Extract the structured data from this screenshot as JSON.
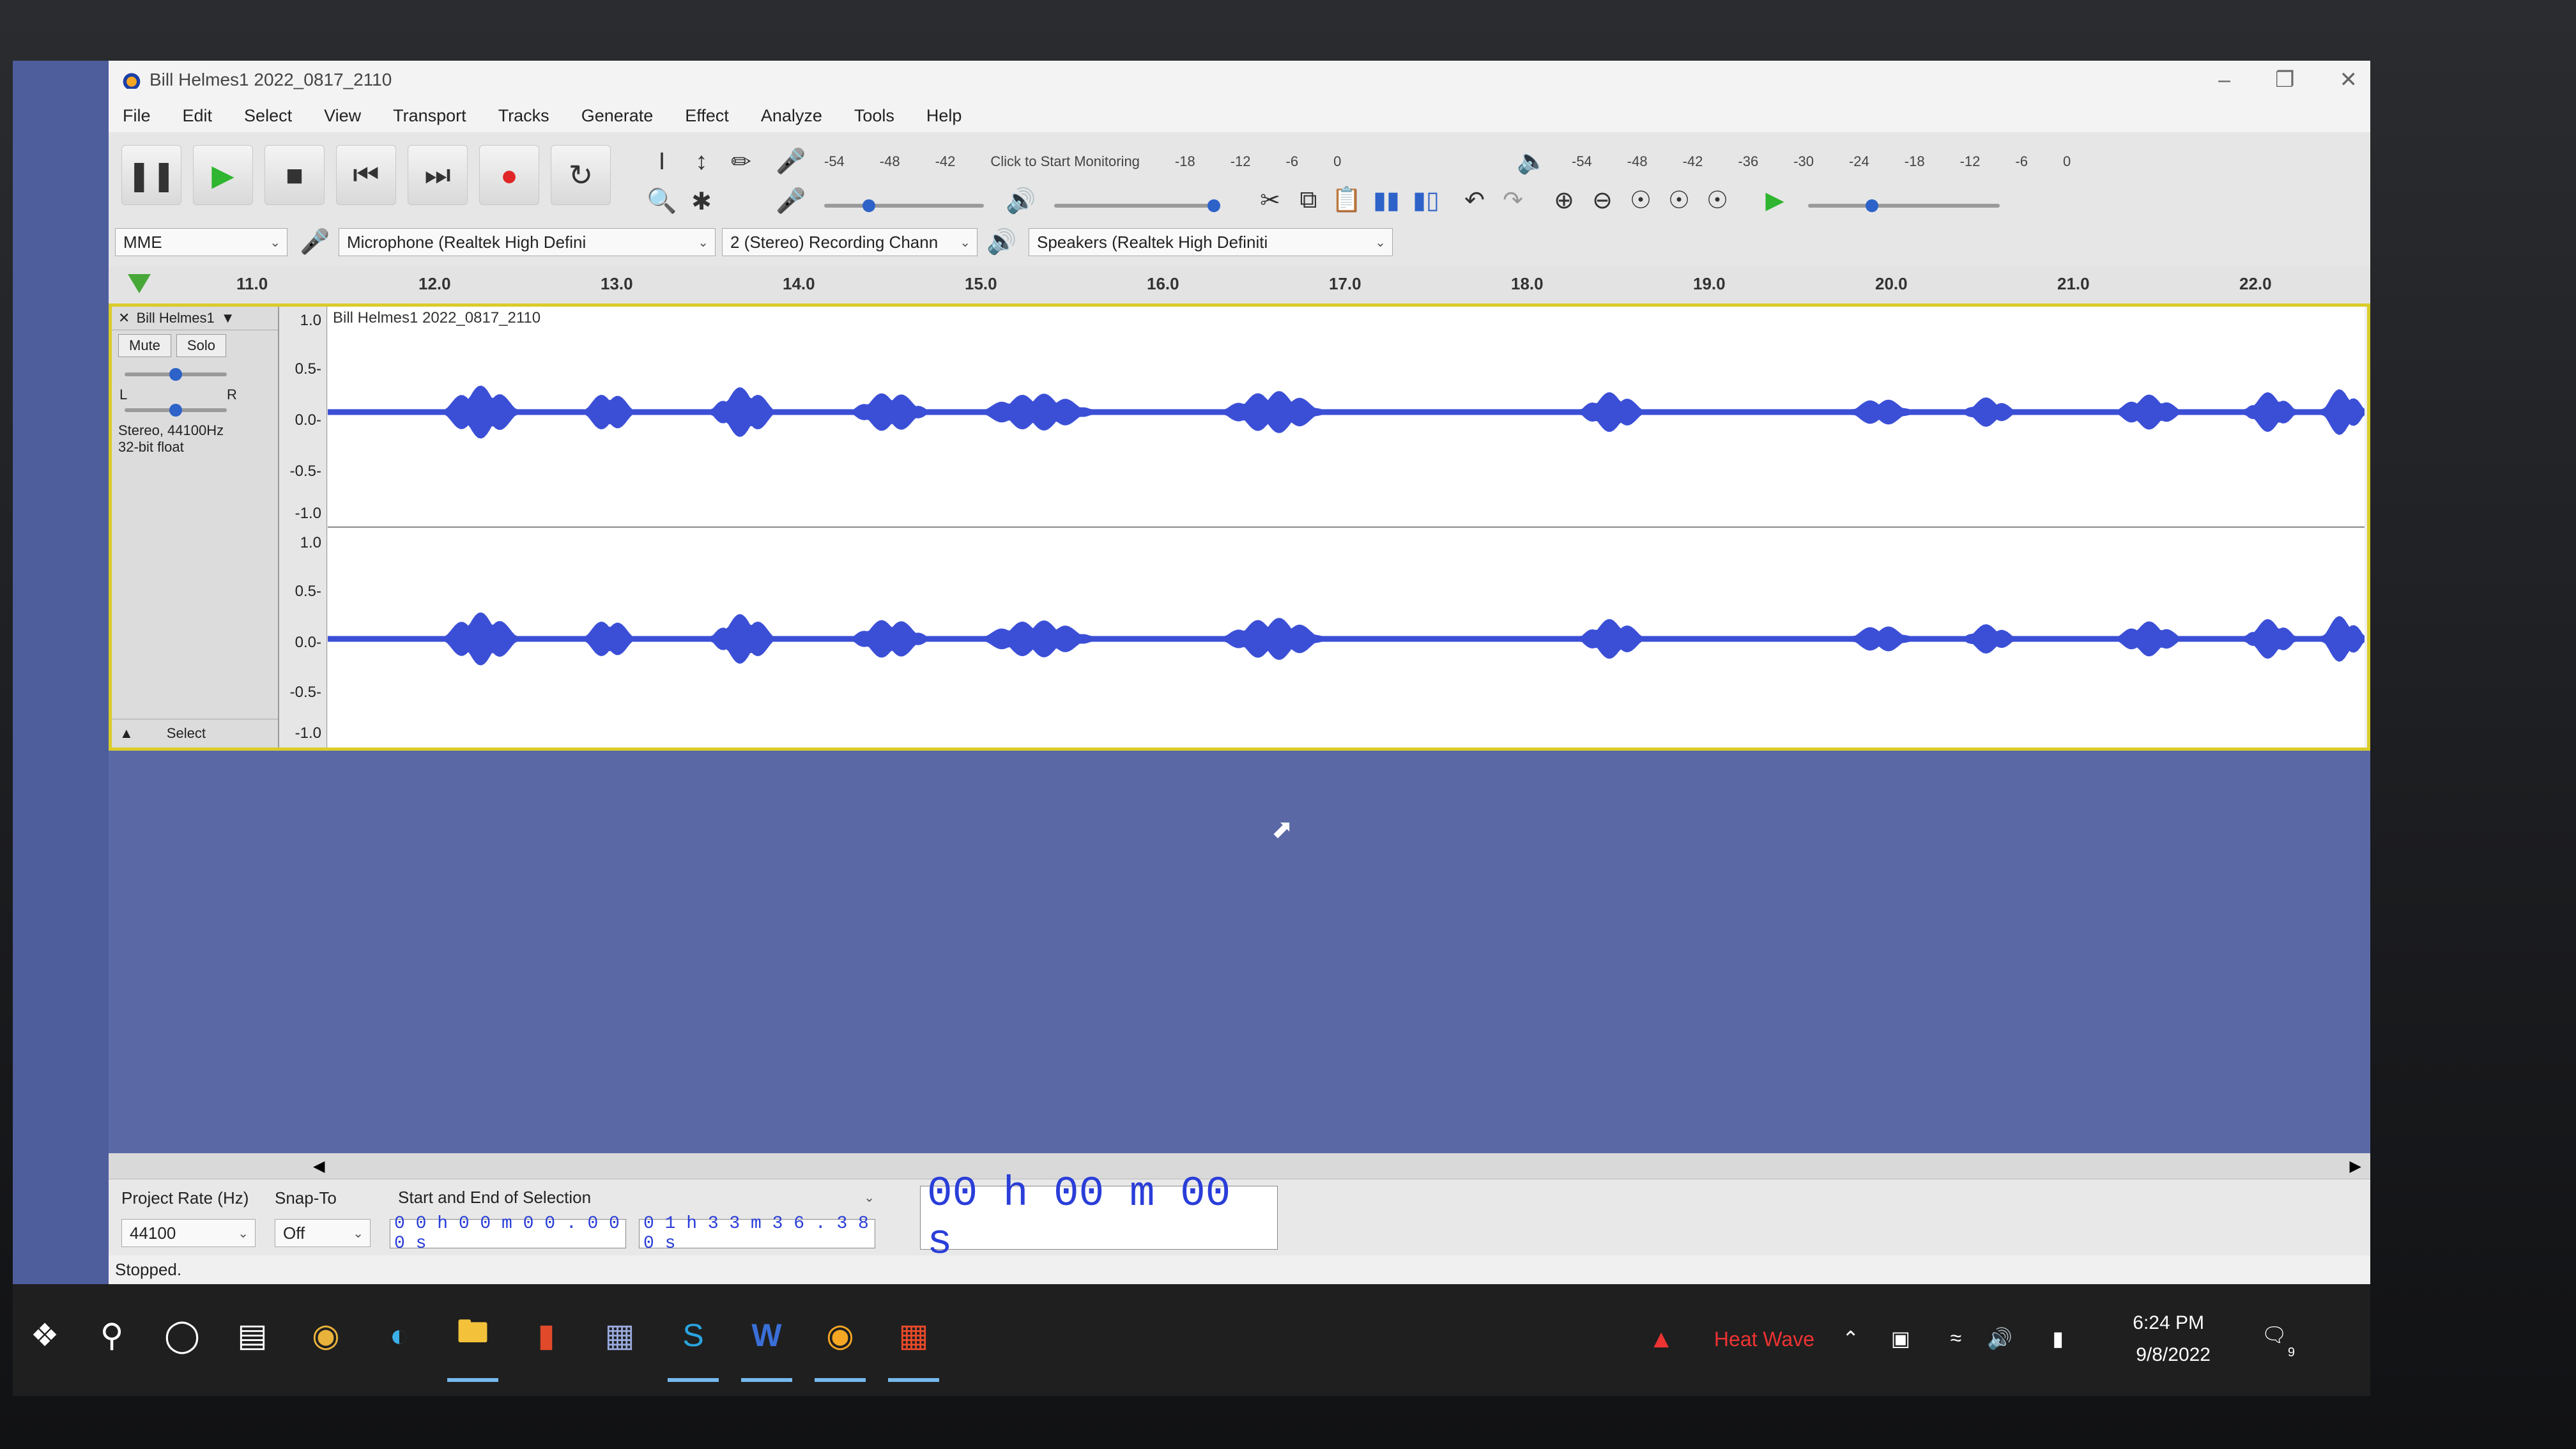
{
  "window": {
    "title": "Bill Helmes1 2022_0817_2110"
  },
  "menu": [
    "File",
    "Edit",
    "Select",
    "View",
    "Transport",
    "Tracks",
    "Generate",
    "Effect",
    "Analyze",
    "Tools",
    "Help"
  ],
  "meters": {
    "record_scale": [
      "-54",
      "-48",
      "-42",
      "Click to Start Monitoring",
      "-18",
      "-12",
      "-6",
      "0"
    ],
    "play_scale": [
      "-54",
      "-48",
      "-42",
      "-36",
      "-30",
      "-24",
      "-18",
      "-12",
      "-6",
      "0"
    ],
    "lr": "L R"
  },
  "device": {
    "host": "MME",
    "input": "Microphone (Realtek High Defini",
    "channels": "2 (Stereo) Recording Chann",
    "output": "Speakers (Realtek High Definiti"
  },
  "ruler": [
    "11.0",
    "12.0",
    "13.0",
    "14.0",
    "15.0",
    "16.0",
    "17.0",
    "18.0",
    "19.0",
    "20.0",
    "21.0",
    "22.0"
  ],
  "track": {
    "name": "Bill Helmes1",
    "clip_name": "Bill Helmes1 2022_0817_2110",
    "mute": "Mute",
    "solo": "Solo",
    "info": "Stereo, 44100Hz",
    "format": "32-bit float",
    "select": "Select",
    "pan_l": "L",
    "pan_r": "R",
    "scale_top": [
      "1.0",
      "0.5-",
      "0.0-",
      "-0.5-",
      "-1.0"
    ],
    "scale_bottom": [
      "1.0",
      "0.5-",
      "0.0-",
      "-0.5-",
      "-1.0"
    ]
  },
  "selection": {
    "rate_label": "Project Rate (Hz)",
    "rate_value": "44100",
    "snap_label": "Snap-To",
    "snap_value": "Off",
    "mode": "Start and End of Selection",
    "start": "0 0 h 0 0 m 0 0 . 0 0 0 s",
    "end": "0 1 h 3 3 m 3 6 . 3 8 0 s",
    "big_time": "00 h 00 m 00 s"
  },
  "status": "Stopped.",
  "taskbar": {
    "weather": "Heat Wave",
    "time": "6:24 PM",
    "date": "9/8/2022",
    "notif": "9"
  },
  "colors": {
    "waveform": "#3b4fd6",
    "selected_border": "#d9cc2a",
    "record": "#e02626",
    "play": "#2fb52f"
  }
}
